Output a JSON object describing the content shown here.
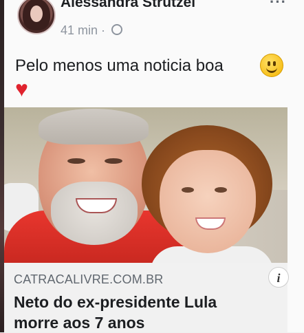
{
  "post": {
    "author": "Alessandra Strutzel",
    "time": "41 min",
    "separator": "·",
    "privacy_icon": "globe-icon",
    "more_label": "···",
    "text": "Pelo menos uma noticia boa",
    "reactions_emojis": [
      "smiling-face-icon",
      "red-heart-icon"
    ]
  },
  "link": {
    "domain": "CATRACALIVRE.COM.BR",
    "title_line1": "Neto do ex-presidente Lula",
    "title_line2": "morre aos 7 anos",
    "info_label": "i"
  },
  "colors": {
    "heart": "#e0232e",
    "shirt": "#e8362e",
    "link_background": "#f1f1f1"
  }
}
